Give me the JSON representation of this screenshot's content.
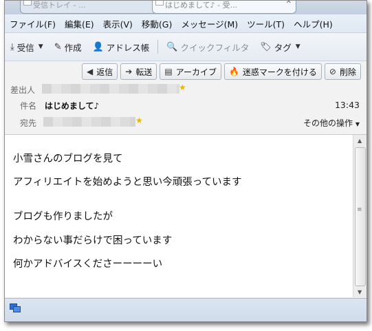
{
  "tabs": [
    {
      "label": "受信トレイ - ..."
    },
    {
      "label": "はじめまして♪ - 受..."
    }
  ],
  "menu": [
    {
      "label": "ファイル(F)"
    },
    {
      "label": "編集(E)"
    },
    {
      "label": "表示(V)"
    },
    {
      "label": "移動(G)"
    },
    {
      "label": "メッセージ(M)"
    },
    {
      "label": "ツール(T)"
    },
    {
      "label": "ヘルプ(H)"
    }
  ],
  "toolbar": {
    "receive": "受信",
    "compose": "作成",
    "address_book": "アドレス帳",
    "quick_filter": "クイックフィルタ",
    "tag": "タグ"
  },
  "actions": {
    "reply": "返信",
    "forward": "転送",
    "archive": "アーカイブ",
    "junk": "迷惑マークを付ける",
    "delete": "削除"
  },
  "header": {
    "from_label": "差出人",
    "subject_label": "件名",
    "subject": "はじめまして♪",
    "to_label": "宛先",
    "time": "13:43",
    "other_actions": "その他の操作"
  },
  "body_lines": [
    "小雪さんのブログを見て",
    "アフィリエイトを始めようと思い今頑張っています",
    "ブログも作りましたが",
    "わからない事だらけで困っています",
    "何かアドバイスくださーーーーい"
  ],
  "icons": {
    "receive": "download-icon",
    "compose": "pencil-icon",
    "address_book": "person-icon",
    "quick_filter": "magnifier-icon",
    "tag": "tag-icon",
    "reply": "reply-arrow-icon",
    "forward": "forward-arrow-icon",
    "archive": "archive-box-icon",
    "junk": "flame-icon",
    "delete": "no-entry-icon",
    "status": "network-icon"
  }
}
